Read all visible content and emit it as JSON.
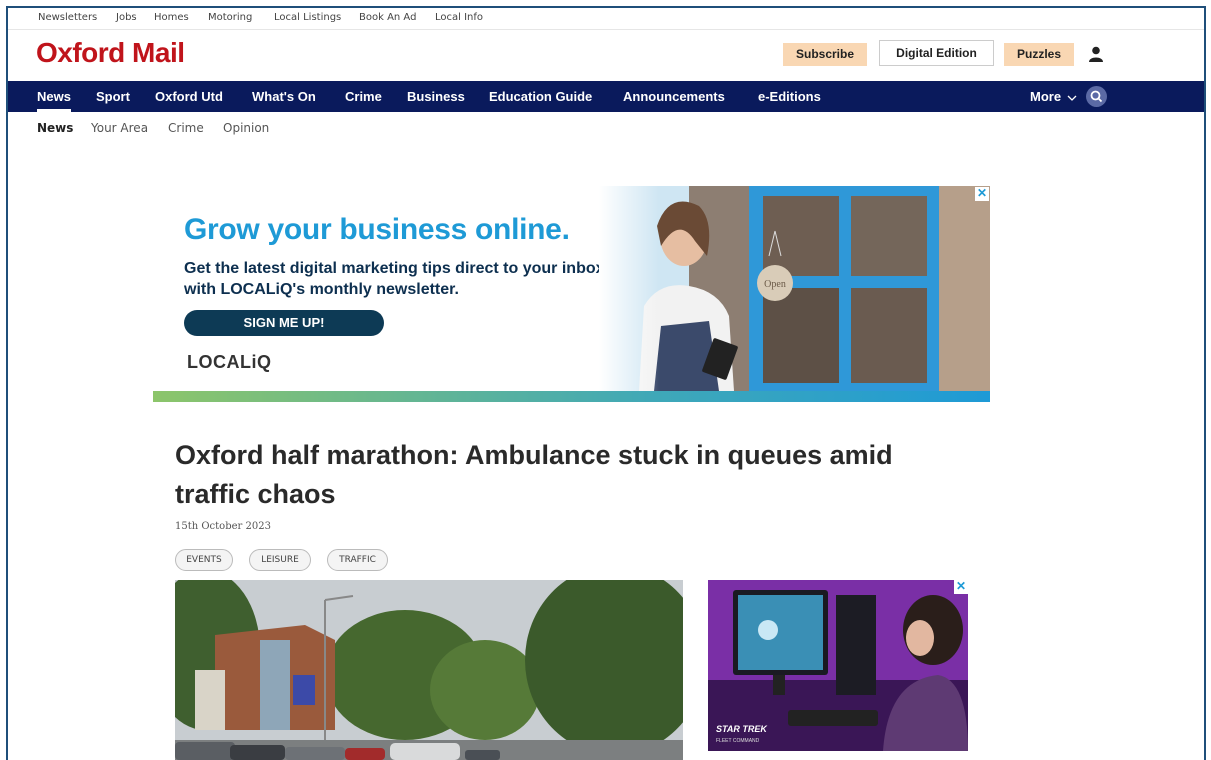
{
  "utility_links": [
    "Newsletters",
    "Jobs",
    "Homes",
    "Motoring",
    "Local Listings",
    "Book An Ad",
    "Local Info"
  ],
  "brand": {
    "name": "Oxford Mail",
    "color": "#c0141b"
  },
  "header_buttons": {
    "subscribe": "Subscribe",
    "digital": "Digital Edition",
    "puzzles": "Puzzles"
  },
  "main_nav": [
    "News",
    "Sport",
    "Oxford Utd",
    "What's On",
    "Crime",
    "Business",
    "Education Guide",
    "Announcements",
    "e-Editions"
  ],
  "more_label": "More",
  "sub_nav": [
    "News",
    "Your Area",
    "Crime",
    "Opinion"
  ],
  "ad": {
    "headline": "Grow your business online.",
    "body": "Get the latest digital marketing tips direct to your inbox with LOCALiQ's monthly newsletter.",
    "cta": "SIGN ME UP!",
    "brand": "LOCALiQ",
    "sign": "Open",
    "close": "✕"
  },
  "article": {
    "headline": "Oxford half marathon: Ambulance stuck in queues amid traffic chaos",
    "date": "15th October 2023",
    "tags": [
      "EVENTS",
      "LEISURE",
      "TRAFFIC"
    ]
  },
  "side_ad": {
    "game_title": "STAR TREK",
    "game_subtitle": "FLEET COMMAND",
    "close": "✕"
  },
  "colors": {
    "nav": "#0a1a5c",
    "accent": "#1e9ad6",
    "button_bg": "#f9d7b3"
  }
}
